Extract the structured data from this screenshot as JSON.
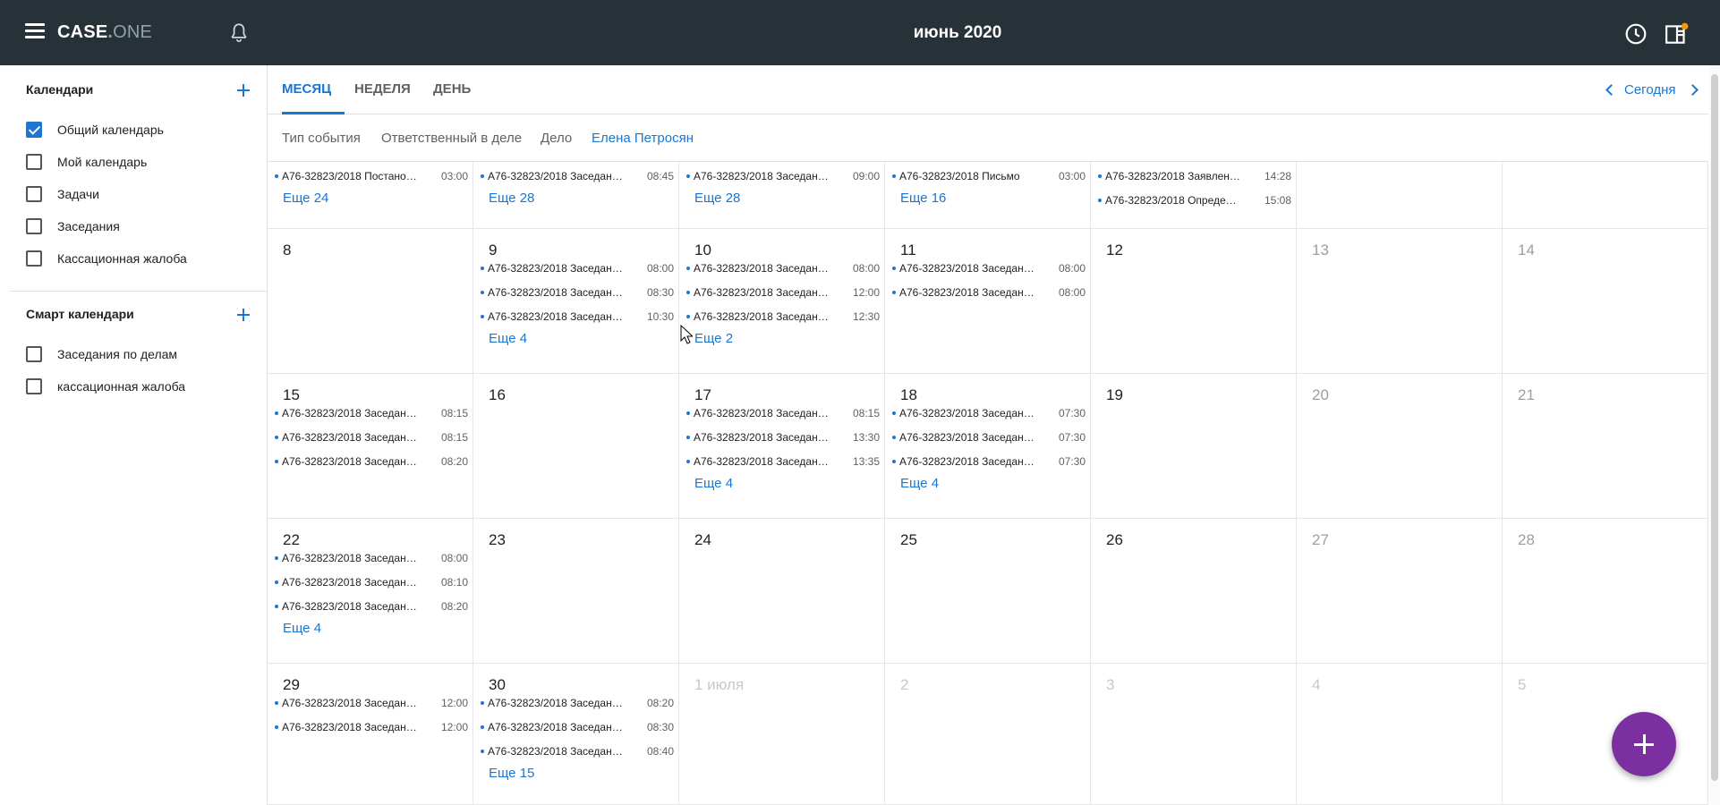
{
  "header": {
    "logo_main": "CASE",
    "logo_dot": ".",
    "logo_suffix": "ONE",
    "title": "июнь 2020",
    "icons": [
      "menu-icon",
      "bell-icon",
      "clock-icon",
      "panel-icon"
    ],
    "colors": {
      "bar": "#263238",
      "accent": "#1976d2",
      "notification": "#ff9800"
    }
  },
  "sidebar": {
    "calendars_title": "Календари",
    "calendars": [
      {
        "label": "Общий календарь",
        "checked": true
      },
      {
        "label": "Мой календарь",
        "checked": false
      },
      {
        "label": "Задачи",
        "checked": false
      },
      {
        "label": "Заседания",
        "checked": false
      },
      {
        "label": "Кассационная жалоба",
        "checked": false
      }
    ],
    "smart_title": "Смарт календари",
    "smart": [
      {
        "label": "Заседания по делам",
        "checked": false
      },
      {
        "label": "кассационная жалоба",
        "checked": false
      }
    ]
  },
  "tabs": [
    {
      "label": "МЕСЯЦ",
      "active": true
    },
    {
      "label": "НЕДЕЛЯ",
      "active": false
    },
    {
      "label": "ДЕНЬ",
      "active": false
    }
  ],
  "nav": {
    "today_label": "Сегодня"
  },
  "filters": [
    "Тип события",
    "Ответственный в деле",
    "Дело"
  ],
  "filter_user": "Елена Петросян",
  "weeks": [
    [
      {
        "day": "",
        "events": [
          [
            "А76-32823/2018 Постано…",
            "03:00"
          ]
        ],
        "more": "Еще 24"
      },
      {
        "day": "",
        "events": [
          [
            "А76-32823/2018 Заседан…",
            "08:45"
          ]
        ],
        "more": "Еще 28"
      },
      {
        "day": "",
        "events": [
          [
            "А76-32823/2018 Заседан…",
            "09:00"
          ]
        ],
        "more": "Еще 28"
      },
      {
        "day": "",
        "events": [
          [
            "А76-32823/2018 Письмо",
            "03:00"
          ]
        ],
        "more": "Еще 16"
      },
      {
        "day": "",
        "events": [
          [
            "А76-32823/2018 Заявлен…",
            "14:28"
          ],
          [
            "А76-32823/2018 Опреде…",
            "15:08"
          ]
        ],
        "more": ""
      },
      {
        "day": "",
        "events": [],
        "more": ""
      },
      {
        "day": "",
        "events": [],
        "more": ""
      }
    ],
    [
      {
        "day": "8",
        "events": [],
        "more": ""
      },
      {
        "day": "9",
        "events": [
          [
            "А76-32823/2018 Заседан…",
            "08:00"
          ],
          [
            "А76-32823/2018 Заседан…",
            "08:30"
          ],
          [
            "А76-32823/2018 Заседан…",
            "10:30"
          ]
        ],
        "more": "Еще 4"
      },
      {
        "day": "10",
        "events": [
          [
            "А76-32823/2018 Заседан…",
            "08:00"
          ],
          [
            "А76-32823/2018 Заседан…",
            "12:00"
          ],
          [
            "А76-32823/2018 Заседан…",
            "12:30"
          ]
        ],
        "more": "Еще 2"
      },
      {
        "day": "11",
        "events": [
          [
            "А76-32823/2018 Заседан…",
            "08:00"
          ],
          [
            "А76-32823/2018 Заседан…",
            "08:00"
          ]
        ],
        "more": ""
      },
      {
        "day": "12",
        "events": [],
        "more": ""
      },
      {
        "day": "13",
        "events": [],
        "more": ""
      },
      {
        "day": "14",
        "events": [],
        "more": ""
      }
    ],
    [
      {
        "day": "15",
        "events": [
          [
            "А76-32823/2018 Заседан…",
            "08:15"
          ],
          [
            "А76-32823/2018 Заседан…",
            "08:15"
          ],
          [
            "А76-32823/2018 Заседан…",
            "08:20"
          ]
        ],
        "more": ""
      },
      {
        "day": "16",
        "events": [],
        "more": ""
      },
      {
        "day": "17",
        "events": [
          [
            "А76-32823/2018 Заседан…",
            "08:15"
          ],
          [
            "А76-32823/2018 Заседан…",
            "13:30"
          ],
          [
            "А76-32823/2018 Заседан…",
            "13:35"
          ]
        ],
        "more": "Еще 4"
      },
      {
        "day": "18",
        "events": [
          [
            "А76-32823/2018 Заседан…",
            "07:30"
          ],
          [
            "А76-32823/2018 Заседан…",
            "07:30"
          ],
          [
            "А76-32823/2018 Заседан…",
            "07:30"
          ]
        ],
        "more": "Еще 4"
      },
      {
        "day": "19",
        "events": [],
        "more": ""
      },
      {
        "day": "20",
        "events": [],
        "more": ""
      },
      {
        "day": "21",
        "events": [],
        "more": ""
      }
    ],
    [
      {
        "day": "22",
        "events": [
          [
            "А76-32823/2018 Заседан…",
            "08:00"
          ],
          [
            "А76-32823/2018 Заседан…",
            "08:10"
          ],
          [
            "А76-32823/2018 Заседан…",
            "08:20"
          ]
        ],
        "more": "Еще 4"
      },
      {
        "day": "23",
        "events": [],
        "more": ""
      },
      {
        "day": "24",
        "events": [],
        "more": ""
      },
      {
        "day": "25",
        "events": [],
        "more": ""
      },
      {
        "day": "26",
        "events": [],
        "more": ""
      },
      {
        "day": "27",
        "events": [],
        "more": ""
      },
      {
        "day": "28",
        "events": [],
        "more": ""
      }
    ],
    [
      {
        "day": "29",
        "events": [
          [
            "А76-32823/2018 Заседан…",
            "12:00"
          ],
          [
            "А76-32823/2018 Заседан…",
            "12:00"
          ]
        ],
        "more": ""
      },
      {
        "day": "30",
        "events": [
          [
            "А76-32823/2018 Заседан…",
            "08:20"
          ],
          [
            "А76-32823/2018 Заседан…",
            "08:30"
          ],
          [
            "А76-32823/2018 Заседан…",
            "08:40"
          ]
        ],
        "more": "Еще 15"
      },
      {
        "day": "1 июля",
        "events": [],
        "more": "",
        "other": true
      },
      {
        "day": "2",
        "events": [],
        "more": "",
        "other": true
      },
      {
        "day": "3",
        "events": [],
        "more": "",
        "other": true
      },
      {
        "day": "4",
        "events": [],
        "more": "",
        "other": true
      },
      {
        "day": "5",
        "events": [],
        "more": "",
        "other": true
      }
    ]
  ]
}
